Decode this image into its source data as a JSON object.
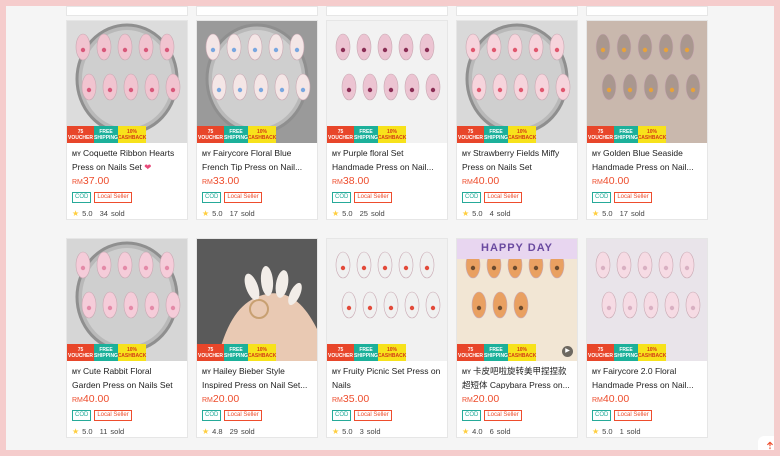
{
  "promo": {
    "voucher": "75\nVOUCHER",
    "shipping": "FREE\nSHIPPING",
    "cashback": "10%\nCASHBACK"
  },
  "labels": {
    "country": "MY",
    "currency": "RM",
    "cod": "COD",
    "local": "Local Seller",
    "sold_suffix": "sold"
  },
  "icons": {
    "star": "star-icon",
    "heart": "heart-icon",
    "play": "play-icon",
    "back_to_top": "arrow-up-icon"
  },
  "colors": {
    "price": "#ee4d2d",
    "cod": "#26aa99",
    "star": "#ffce3d"
  },
  "products": [
    {
      "title": "Coquette Ribbon Hearts Press on Nails Set",
      "heart": "❤",
      "price": "37.00",
      "rating": "5.0",
      "sold": "34"
    },
    {
      "title": "Fairycore Floral Blue French Tip Press on Nail...",
      "price": "33.00",
      "rating": "5.0",
      "sold": "17"
    },
    {
      "title": "Purple floral Set Handmade Press on Nail...",
      "price": "38.00",
      "rating": "5.0",
      "sold": "25"
    },
    {
      "title": "Strawberry Fields Miffy Press on Nails Set",
      "price": "40.00",
      "rating": "5.0",
      "sold": "4"
    },
    {
      "title": "Golden Blue Seaside Handmade Press on Nail...",
      "price": "40.00",
      "rating": "5.0",
      "sold": "17"
    },
    {
      "title": "Cute Rabbit Floral Garden Press on Nails Set",
      "price": "40.00",
      "rating": "5.0",
      "sold": "11"
    },
    {
      "title": "Hailey Bieber Style Inspired Press on Nail Set...",
      "price": "20.00",
      "rating": "4.8",
      "sold": "29"
    },
    {
      "title": "Fruity Picnic Set Press on Nails",
      "price": "35.00",
      "rating": "5.0",
      "sold": "3"
    },
    {
      "title": "卡皮吧啦旋转美甲捏捏款超短体 Capybara Press on...",
      "price": "20.00",
      "rating": "4.0",
      "sold": "6",
      "overlay": "HAPPY DAY",
      "video": true
    },
    {
      "title": "Fairycore 2.0 Floral Handmade Press on Nail...",
      "price": "40.00",
      "rating": "5.0",
      "sold": "1"
    }
  ]
}
